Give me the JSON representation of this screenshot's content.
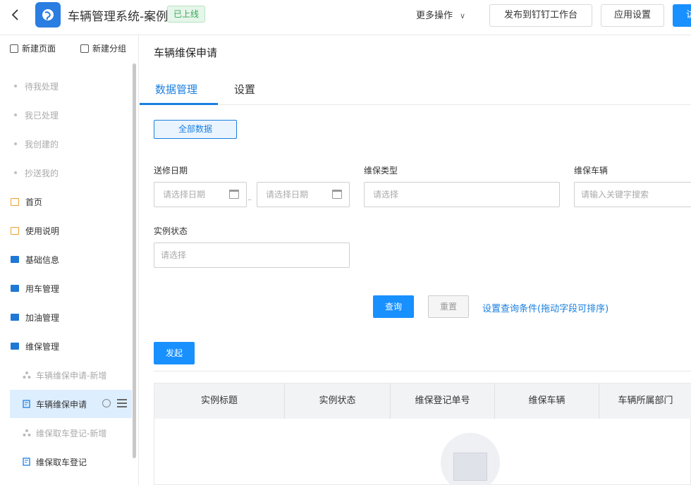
{
  "header": {
    "app_title": "车辆管理系统-案例",
    "status_badge": "已上线",
    "more_ops": "更多操作",
    "publish_btn": "发布到钉钉工作台",
    "settings_btn": "应用设置",
    "primary_btn_partial": "访"
  },
  "sidebar": {
    "new_page": "新建页面",
    "new_group": "新建分组",
    "items": [
      {
        "label": "待我处理"
      },
      {
        "label": "我已处理"
      },
      {
        "label": "我创建的"
      },
      {
        "label": "抄送我的"
      },
      {
        "label": "首页"
      },
      {
        "label": "使用说明"
      },
      {
        "label": "基础信息"
      },
      {
        "label": "用车管理"
      },
      {
        "label": "加油管理"
      },
      {
        "label": "维保管理"
      },
      {
        "label": "车辆维保申请-新增"
      },
      {
        "label": "车辆维保申请"
      },
      {
        "label": "维保取车登记-新增"
      },
      {
        "label": "维保取车登记"
      }
    ]
  },
  "main": {
    "page_title": "车辆维保申请",
    "tabs": [
      {
        "label": "数据管理"
      },
      {
        "label": "设置"
      }
    ],
    "filter_pill": "全部数据",
    "filters": {
      "send_date_label": "送修日期",
      "date_start_placeholder": "请选择日期",
      "date_end_placeholder": "请选择日期",
      "maint_type_label": "维保类型",
      "maint_type_placeholder": "请选择",
      "maint_vehicle_label": "维保车辆",
      "maint_vehicle_placeholder": "请输入关键字搜索",
      "instance_status_label": "实例状态",
      "instance_status_placeholder": "请选择"
    },
    "query_btn": "查询",
    "reset_btn": "重置",
    "config_link": "设置查询条件(拖动字段可排序)",
    "launch_btn": "发起",
    "table_headers": [
      "实例标题",
      "实例状态",
      "维保登记单号",
      "维保车辆",
      "车辆所属部门"
    ]
  },
  "colors": {
    "accent": "#1890ff",
    "folder": "#1f78d6",
    "page_icon": "#f0a030",
    "online_badge": "#3aa85a"
  }
}
